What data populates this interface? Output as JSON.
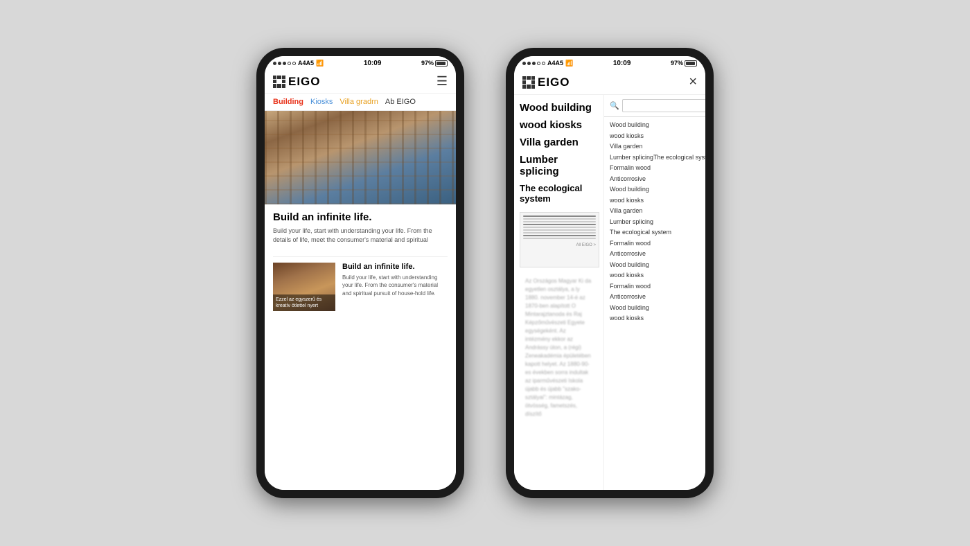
{
  "background": "#d8d8d8",
  "phone1": {
    "statusBar": {
      "dots": [
        "filled",
        "filled",
        "filled",
        "empty",
        "empty"
      ],
      "carrier": "A4A5",
      "wifi": true,
      "time": "10:09",
      "battery": "97%"
    },
    "header": {
      "logoText": "EIGO",
      "menuIcon": "☰"
    },
    "navItems": [
      {
        "label": "Building",
        "color": "#E8341C",
        "active": true
      },
      {
        "label": "Kiosks",
        "color": "#4A90D9"
      },
      {
        "label": "Villa gradrn",
        "color": "#E8A020"
      },
      {
        "label": "Ab EIGO",
        "color": "#333"
      }
    ],
    "heroImage": {
      "alt": "Wood building exterior"
    },
    "mainArticle": {
      "title": "Build an infinite life.",
      "text": "Build your life, start with understanding your life. From the details of life, meet the consumer's material and spiritual"
    },
    "secondArticle": {
      "title": "Build an infinite life.",
      "text": "Build your life, start with understanding your life. From the consumer's material and spiritual pursuit of house-hold life.",
      "thumbCaption": "Ezzel az egyszerű és kreatív ötlettel nyert"
    }
  },
  "phone2": {
    "statusBar": {
      "carrier": "A4A5",
      "time": "10:09",
      "battery": "97%"
    },
    "header": {
      "logoText": "EIGO",
      "closeIcon": "×"
    },
    "menuItems": [
      {
        "label": "Wood building",
        "size": "large"
      },
      {
        "label": "wood kiosks",
        "size": "large"
      },
      {
        "label": "Villa garden",
        "size": "large"
      },
      {
        "label": "Lumber splicing",
        "size": "large"
      },
      {
        "label": "The ecological system",
        "size": "large"
      }
    ],
    "searchPlaceholder": "",
    "searchResults": [
      "Wood building",
      "wood kiosks",
      "Villa garden",
      "Lumber splicingThe ecological system",
      "Formalin wood",
      "Anticorrosive",
      "Wood building",
      "wood kiosks",
      "Villa garden",
      "Lumber splicing",
      "The ecological system",
      "Formalin wood",
      "Anticorrosive",
      "Wood building",
      "wood kiosks",
      "Formalin wood",
      "Anticorrosive",
      "Wood building",
      "wood kiosks"
    ],
    "blurredText": "Az Országos Magyar Ki da egyetlen osztálya, a ly 1880. november 14-é az 1870-ben alapított O Mintarajztanoda és Raj Képzőművészeti Egyete egységeként. Az intézmény ekkor az Andrássy úton, a (régi) Zeneakadémia épületében kapott helyet. Az 1880-90-es években sorra indultak az iparművészeti Iskola újabb és újabb \"szako-sztályai\": mintázag, ötvösség, fametsz­és, díszítő"
  }
}
